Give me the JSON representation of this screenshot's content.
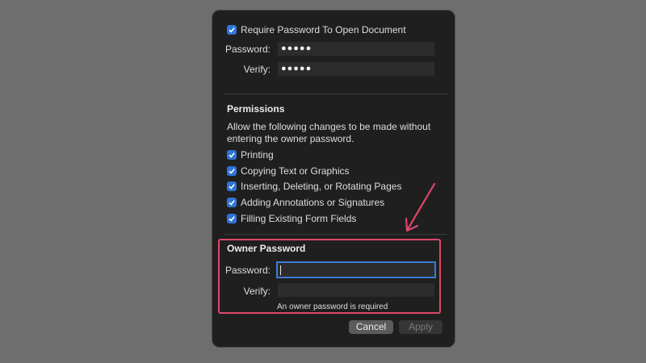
{
  "open_section": {
    "require_label": "Require Password To Open Document",
    "password_label": "Password:",
    "password_value": "●●●●●",
    "verify_label": "Verify:",
    "verify_value": "●●●●●"
  },
  "permissions": {
    "heading": "Permissions",
    "description": "Allow the following changes to be made without entering the owner password.",
    "items": [
      {
        "label": "Printing",
        "checked": true
      },
      {
        "label": "Copying Text or Graphics",
        "checked": true
      },
      {
        "label": "Inserting, Deleting, or Rotating Pages",
        "checked": true
      },
      {
        "label": "Adding Annotations or Signatures",
        "checked": true
      },
      {
        "label": "Filling Existing Form Fields",
        "checked": true
      }
    ]
  },
  "owner": {
    "heading": "Owner Password",
    "password_label": "Password:",
    "password_value": "",
    "verify_label": "Verify:",
    "verify_value": "",
    "message": "An owner password is required"
  },
  "buttons": {
    "cancel": "Cancel",
    "apply": "Apply"
  },
  "colors": {
    "accent": "#2f74d6",
    "annotation": "#e0466a"
  }
}
